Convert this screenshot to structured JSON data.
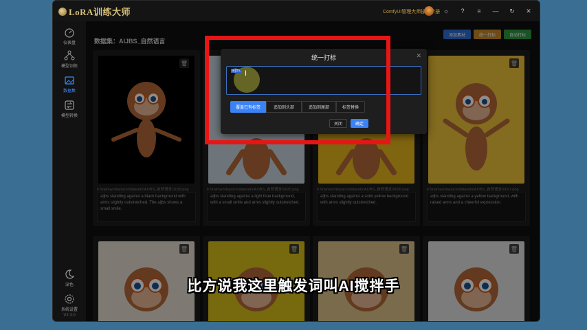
{
  "app": {
    "logo_text": "LoRA训练大师",
    "manual_link": "ComfyUI管理大师操作手册"
  },
  "sidebar": {
    "items": [
      {
        "label": "仪表盘",
        "icon": "dashboard-icon"
      },
      {
        "label": "模型训练",
        "icon": "network-icon"
      },
      {
        "label": "数据集",
        "icon": "image-icon",
        "active": true
      },
      {
        "label": "模型转换",
        "icon": "convert-icon"
      }
    ],
    "bottom": [
      {
        "label": "深色",
        "icon": "moon-icon"
      },
      {
        "label": "系统设置",
        "icon": "gear-icon"
      }
    ],
    "version": "V2.3.0"
  },
  "page": {
    "title": "数据集：AIJBS_自然语言",
    "buttons": {
      "add": "添加素材",
      "batch_tag": "统一打标",
      "auto_tag": "自动打标"
    }
  },
  "cards": [
    {
      "path": "F:\\train\\workspace\\datasets\\AIJBS_自然语言\\1018.png",
      "caption": "aijbs standing against a black background with arms slightly outstretched. The aijbs shows a small smile.",
      "bg": "#000000"
    },
    {
      "path": "F:\\train\\workspace\\datasets\\AIJBS_自然语言\\0025.png",
      "caption": "aijbs standing against a light blue background, with a small smile and arms slightly outstretched.",
      "bg": "#c9d6df"
    },
    {
      "path": "F:\\train\\workspace\\datasets\\AIJBS_自然语言\\0026.png",
      "caption": "aijbs standing against a solid yellow background with arms slightly outstretched.",
      "bg": "#e8b81c"
    },
    {
      "path": "F:\\train\\workspace\\datasets\\AIJBS_自然语言\\0027.png",
      "caption": "aijbs standing against a yellow background, with raised arms and a cheerful expression.",
      "bg": "#efc43a"
    },
    {
      "path": "",
      "caption": "",
      "bg": "#e6dfd2"
    },
    {
      "path": "",
      "caption": "",
      "bg": "#d9c21a"
    },
    {
      "path": "",
      "caption": "",
      "bg": "#ddc48a"
    },
    {
      "path": "",
      "caption": "",
      "bg": "#e2e2e2"
    }
  ],
  "modal": {
    "title": "统一打标",
    "input_value": "aijbs,",
    "modes": [
      "覆盖已有标签",
      "追加到头部",
      "追加到尾部",
      "标签替换"
    ],
    "active_mode": 0,
    "cancel": "关闭",
    "confirm": "确定"
  },
  "subtitle": "比方说我这里触发词叫AI搅拌手",
  "colors": {
    "accent": "#3b82f6",
    "highlight": "#e81515",
    "btn_add": "#2f6fd6",
    "btn_batch": "#c98a2a",
    "btn_auto": "#2f9a44"
  }
}
